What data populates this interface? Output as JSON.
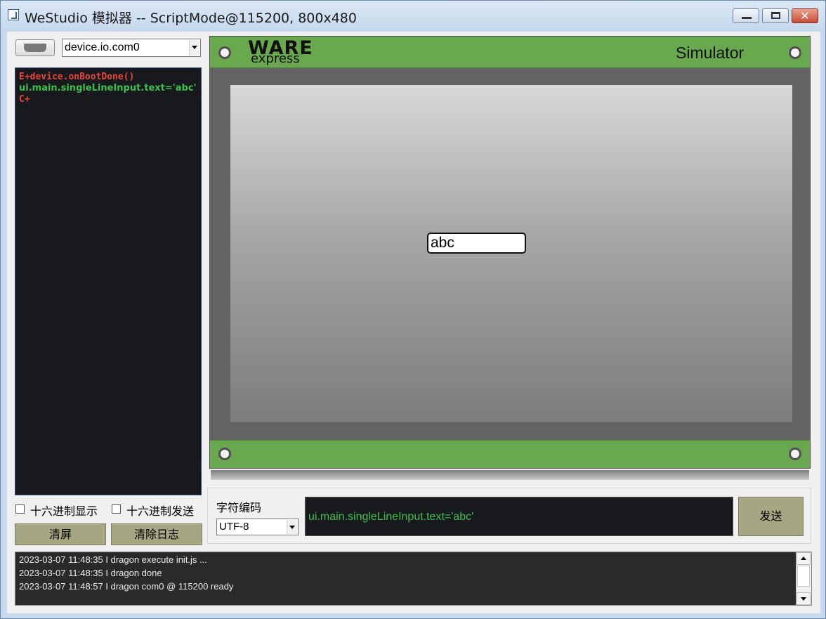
{
  "window": {
    "title": "WeStudio 模拟器 -- ScriptMode@115200, 800x480",
    "close_glyph": "✕"
  },
  "port": {
    "selected": "device.io.com0"
  },
  "script_log": {
    "lines": [
      {
        "text": "E+device.onBootDone()",
        "color": "#e8443a"
      },
      {
        "text": "ui.main.singleLineInput.text='abc'",
        "color": "#3fbf52"
      },
      {
        "text": "C+",
        "color": "#e8443a"
      }
    ]
  },
  "options": {
    "hex_display_label": "十六进制显示",
    "hex_display_checked": false,
    "hex_send_label": "十六进制发送",
    "hex_send_checked": false
  },
  "buttons": {
    "clear_screen": "清屏",
    "clear_log": "清除日志",
    "send": "发送"
  },
  "simulator": {
    "logo_main": "WARE",
    "logo_sub": "express",
    "title": "Simulator",
    "screen": {
      "single_line_input_text": "abc"
    },
    "colors": {
      "board_green": "#6aa84f",
      "board_gray": "#636363"
    }
  },
  "send_panel": {
    "encoding_label": "字符编码",
    "encoding_selected": "UTF-8",
    "command_text": "ui.main.singleLineInput.text='abc'"
  },
  "log": {
    "lines": [
      "2023-03-07 11:48:35 I dragon execute init.js ...",
      "2023-03-07 11:48:35 I dragon done",
      "2023-03-07 11:48:57 I dragon com0 @ 115200 ready"
    ]
  }
}
